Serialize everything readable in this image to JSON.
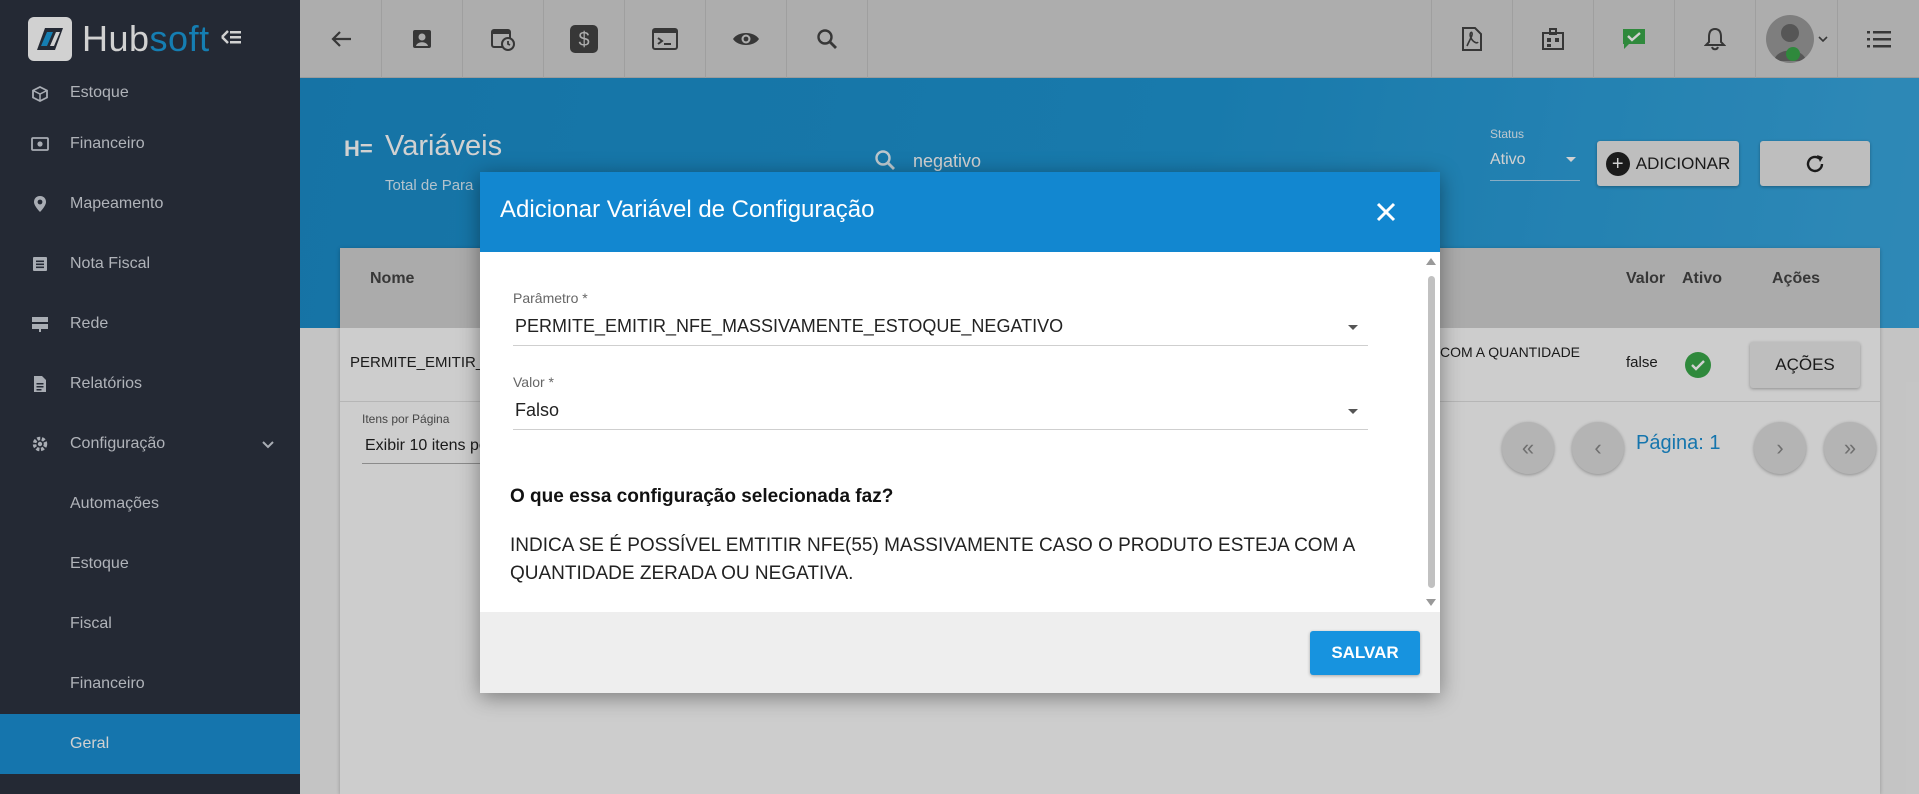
{
  "brand": {
    "hub": "Hub",
    "soft": "soft"
  },
  "sidebar": {
    "items": [
      {
        "label": "Estoque",
        "icon": "box-icon"
      },
      {
        "label": "Financeiro",
        "icon": "money-icon"
      },
      {
        "label": "Mapeamento",
        "icon": "map-pin-icon"
      },
      {
        "label": "Nota Fiscal",
        "icon": "receipt-icon"
      },
      {
        "label": "Rede",
        "icon": "server-icon"
      },
      {
        "label": "Relatórios",
        "icon": "document-icon"
      },
      {
        "label": "Configuração",
        "icon": "gear-icon"
      }
    ],
    "subitems": [
      {
        "label": "Automações"
      },
      {
        "label": "Estoque"
      },
      {
        "label": "Fiscal"
      },
      {
        "label": "Financeiro"
      },
      {
        "label": "Geral"
      }
    ]
  },
  "page": {
    "title": "Variáveis",
    "subtitle": "Total de Para",
    "search_value": "negativo",
    "status_label": "Status",
    "status_value": "Ativo",
    "add_label": "ADICIONAR"
  },
  "table": {
    "headers": {
      "name": "Nome",
      "value": "Valor",
      "active": "Ativo",
      "actions": "Ações"
    },
    "row": {
      "name": "PERMITE_EMITIR_",
      "desc_partial": "COM A QUANTIDADE",
      "value": "false",
      "actions_label": "AÇÕES"
    },
    "items_per_page_label": "Itens por Página",
    "items_per_page_value": "Exibir 10 itens po",
    "page_label": "Página: 1"
  },
  "modal": {
    "title": "Adicionar Variável de Configuração",
    "param_label": "Parâmetro *",
    "param_value": "PERMITE_EMITIR_NFE_MASSIVAMENTE_ESTOQUE_NEGATIVO",
    "value_label": "Valor *",
    "value_value": "Falso",
    "question": "O que essa configuração selecionada faz?",
    "description": "INDICA SE É POSSÍVEL EMTITIR NFE(55) MASSIVAMENTE CASO O PRODUTO ESTEJA COM A QUANTIDADE ZERADA OU NEGATIVA.",
    "save_label": "SALVAR"
  },
  "colors": {
    "primary": "#1287d0",
    "sidebar": "#2c3240",
    "success": "#3aa84a"
  }
}
